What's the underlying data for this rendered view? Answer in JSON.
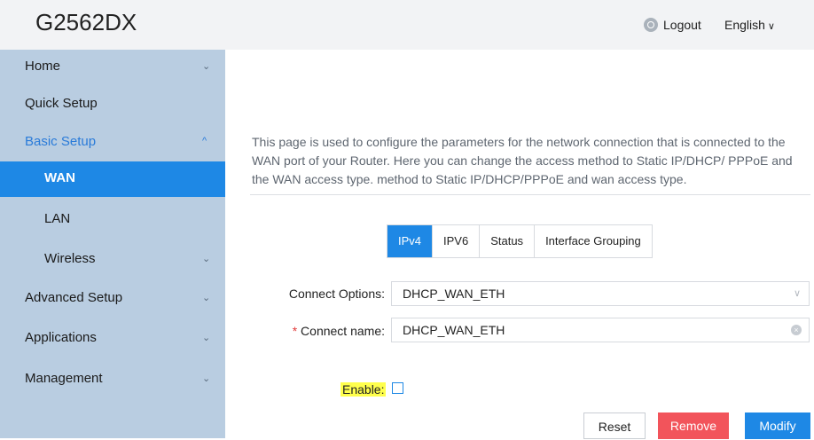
{
  "header": {
    "brand": "G2562DX",
    "logout_label": "Logout",
    "language_label": "English",
    "language_chevron": "∨"
  },
  "sidebar": {
    "items": [
      {
        "label": "Home",
        "chevron": "⌄"
      },
      {
        "label": "Quick Setup"
      },
      {
        "label": "Basic Setup",
        "chevron": "^"
      },
      {
        "label": "WAN"
      },
      {
        "label": "LAN"
      },
      {
        "label": "Wireless",
        "chevron": "⌄"
      },
      {
        "label": "Advanced Setup",
        "chevron": "⌄"
      },
      {
        "label": "Applications",
        "chevron": "⌄"
      },
      {
        "label": "Management",
        "chevron": "⌄"
      }
    ]
  },
  "main": {
    "description": "This page is used to configure the parameters for the network connection that is connected to the WAN port of your Router. Here you can change the access method to Static IP/DHCP/ PPPoE and the WAN access type. method to Static IP/DHCP/PPPoE and wan access type.",
    "tabs": [
      {
        "label": "IPv4"
      },
      {
        "label": "IPV6"
      },
      {
        "label": "Status"
      },
      {
        "label": "Interface Grouping"
      }
    ],
    "form": {
      "connect_options_label": "Connect Options:",
      "connect_options_value": "DHCP_WAN_ETH",
      "connect_name_required": "*",
      "connect_name_label": "Connect name:",
      "connect_name_value": "DHCP_WAN_ETH",
      "enable_label": "Enable:"
    },
    "buttons": {
      "reset": "Reset",
      "remove": "Remove",
      "modify": "Modify"
    }
  },
  "colors": {
    "sidebar_bg": "#b9cde1",
    "accent_blue": "#1e88e5",
    "remove_red": "#f2545b",
    "highlight_yellow": "#ffff4d"
  },
  "icons": {
    "logout": "logout-icon",
    "dropdown": "chevron-down-icon",
    "clear": "clear-icon"
  }
}
